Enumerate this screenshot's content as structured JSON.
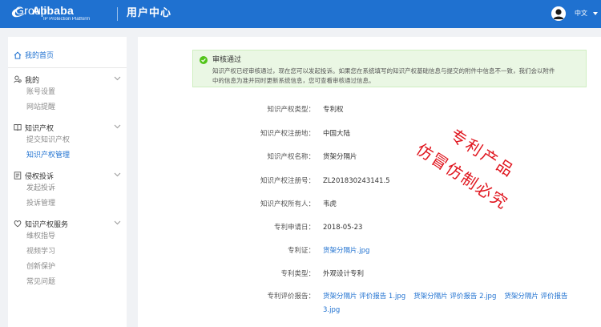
{
  "header": {
    "logo_name": "Alibaba",
    "logo_group": " Group",
    "logo_sub": "IP Protection Platform",
    "center_title": "用户中心",
    "language": "中文",
    "accent": "#1f71d0"
  },
  "sidebar": {
    "home": "我的首页",
    "groups": [
      {
        "title": "我的",
        "icon": "user-icon",
        "items": [
          "账号设置",
          "网站提醒"
        ]
      },
      {
        "title": "知识产权",
        "icon": "book-icon",
        "items": [
          "提交知识产权",
          "知识产权管理"
        ],
        "active_item": "知识产权管理"
      },
      {
        "title": "侵权投诉",
        "icon": "document-icon",
        "items": [
          "发起投诉",
          "投诉管理"
        ]
      },
      {
        "title": "知识产权服务",
        "icon": "heart-icon",
        "items": [
          "维权指导",
          "视频学习",
          "创新保护",
          "常见问题"
        ]
      }
    ]
  },
  "alert": {
    "title": "审核通过",
    "line1": "知识产权已经审核通过，现在您可以发起投诉。如果您在系统填写的知识产权基础信息与提交的附件中信息不一致，我们会以附件",
    "line2": "中的信息为准并同时更新系统信息，您可查看审核通过信息。",
    "color": "#52c41a"
  },
  "details": {
    "type": {
      "label": "知识产权类型：",
      "value": "专利权"
    },
    "region": {
      "label": "知识产权注册地：",
      "value": "中国大陆"
    },
    "name": {
      "label": "知识产权名称：",
      "value": "货架分隔片"
    },
    "reg_no": {
      "label": "知识产权注册号：",
      "value": "ZL201830243141.5"
    },
    "owner": {
      "label": "知识产权所有人：",
      "value": "韦虎"
    },
    "apply_date": {
      "label": "专利申请日：",
      "value": "2018-05-23"
    },
    "certificate": {
      "label": "专利证：",
      "value": "货架分隔片.jpg"
    },
    "patent_type": {
      "label": "专利类型：",
      "value": "外观设计专利"
    },
    "reports": {
      "label": "专利评价报告：",
      "files": [
        "货架分隔片 评价报告 1.jpg",
        "货架分隔片 评价报告 2.jpg",
        "货架分隔片 评价报告 3.jpg"
      ]
    }
  },
  "stamp": {
    "line1": "专利产品",
    "line2": "仿冒仿制必究",
    "color": "#e0161f"
  }
}
